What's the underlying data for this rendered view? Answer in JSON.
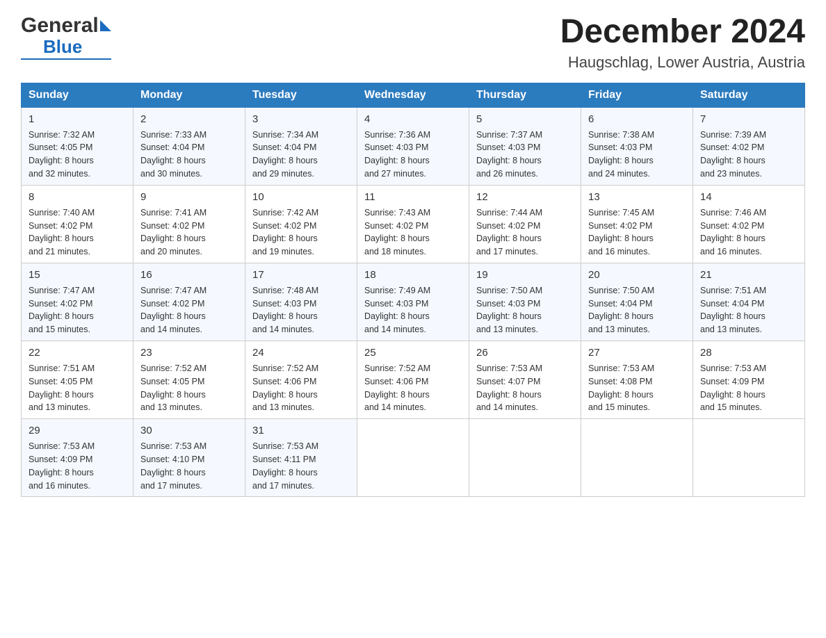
{
  "logo": {
    "general": "General",
    "blue": "Blue"
  },
  "title": "December 2024",
  "location": "Haugschlag, Lower Austria, Austria",
  "weekdays": [
    "Sunday",
    "Monday",
    "Tuesday",
    "Wednesday",
    "Thursday",
    "Friday",
    "Saturday"
  ],
  "weeks": [
    [
      {
        "day": "1",
        "sunrise": "7:32 AM",
        "sunset": "4:05 PM",
        "daylight": "8 hours and 32 minutes."
      },
      {
        "day": "2",
        "sunrise": "7:33 AM",
        "sunset": "4:04 PM",
        "daylight": "8 hours and 30 minutes."
      },
      {
        "day": "3",
        "sunrise": "7:34 AM",
        "sunset": "4:04 PM",
        "daylight": "8 hours and 29 minutes."
      },
      {
        "day": "4",
        "sunrise": "7:36 AM",
        "sunset": "4:03 PM",
        "daylight": "8 hours and 27 minutes."
      },
      {
        "day": "5",
        "sunrise": "7:37 AM",
        "sunset": "4:03 PM",
        "daylight": "8 hours and 26 minutes."
      },
      {
        "day": "6",
        "sunrise": "7:38 AM",
        "sunset": "4:03 PM",
        "daylight": "8 hours and 24 minutes."
      },
      {
        "day": "7",
        "sunrise": "7:39 AM",
        "sunset": "4:02 PM",
        "daylight": "8 hours and 23 minutes."
      }
    ],
    [
      {
        "day": "8",
        "sunrise": "7:40 AM",
        "sunset": "4:02 PM",
        "daylight": "8 hours and 21 minutes."
      },
      {
        "day": "9",
        "sunrise": "7:41 AM",
        "sunset": "4:02 PM",
        "daylight": "8 hours and 20 minutes."
      },
      {
        "day": "10",
        "sunrise": "7:42 AM",
        "sunset": "4:02 PM",
        "daylight": "8 hours and 19 minutes."
      },
      {
        "day": "11",
        "sunrise": "7:43 AM",
        "sunset": "4:02 PM",
        "daylight": "8 hours and 18 minutes."
      },
      {
        "day": "12",
        "sunrise": "7:44 AM",
        "sunset": "4:02 PM",
        "daylight": "8 hours and 17 minutes."
      },
      {
        "day": "13",
        "sunrise": "7:45 AM",
        "sunset": "4:02 PM",
        "daylight": "8 hours and 16 minutes."
      },
      {
        "day": "14",
        "sunrise": "7:46 AM",
        "sunset": "4:02 PM",
        "daylight": "8 hours and 16 minutes."
      }
    ],
    [
      {
        "day": "15",
        "sunrise": "7:47 AM",
        "sunset": "4:02 PM",
        "daylight": "8 hours and 15 minutes."
      },
      {
        "day": "16",
        "sunrise": "7:47 AM",
        "sunset": "4:02 PM",
        "daylight": "8 hours and 14 minutes."
      },
      {
        "day": "17",
        "sunrise": "7:48 AM",
        "sunset": "4:03 PM",
        "daylight": "8 hours and 14 minutes."
      },
      {
        "day": "18",
        "sunrise": "7:49 AM",
        "sunset": "4:03 PM",
        "daylight": "8 hours and 14 minutes."
      },
      {
        "day": "19",
        "sunrise": "7:50 AM",
        "sunset": "4:03 PM",
        "daylight": "8 hours and 13 minutes."
      },
      {
        "day": "20",
        "sunrise": "7:50 AM",
        "sunset": "4:04 PM",
        "daylight": "8 hours and 13 minutes."
      },
      {
        "day": "21",
        "sunrise": "7:51 AM",
        "sunset": "4:04 PM",
        "daylight": "8 hours and 13 minutes."
      }
    ],
    [
      {
        "day": "22",
        "sunrise": "7:51 AM",
        "sunset": "4:05 PM",
        "daylight": "8 hours and 13 minutes."
      },
      {
        "day": "23",
        "sunrise": "7:52 AM",
        "sunset": "4:05 PM",
        "daylight": "8 hours and 13 minutes."
      },
      {
        "day": "24",
        "sunrise": "7:52 AM",
        "sunset": "4:06 PM",
        "daylight": "8 hours and 13 minutes."
      },
      {
        "day": "25",
        "sunrise": "7:52 AM",
        "sunset": "4:06 PM",
        "daylight": "8 hours and 14 minutes."
      },
      {
        "day": "26",
        "sunrise": "7:53 AM",
        "sunset": "4:07 PM",
        "daylight": "8 hours and 14 minutes."
      },
      {
        "day": "27",
        "sunrise": "7:53 AM",
        "sunset": "4:08 PM",
        "daylight": "8 hours and 15 minutes."
      },
      {
        "day": "28",
        "sunrise": "7:53 AM",
        "sunset": "4:09 PM",
        "daylight": "8 hours and 15 minutes."
      }
    ],
    [
      {
        "day": "29",
        "sunrise": "7:53 AM",
        "sunset": "4:09 PM",
        "daylight": "8 hours and 16 minutes."
      },
      {
        "day": "30",
        "sunrise": "7:53 AM",
        "sunset": "4:10 PM",
        "daylight": "8 hours and 17 minutes."
      },
      {
        "day": "31",
        "sunrise": "7:53 AM",
        "sunset": "4:11 PM",
        "daylight": "8 hours and 17 minutes."
      },
      null,
      null,
      null,
      null
    ]
  ],
  "labels": {
    "sunrise": "Sunrise:",
    "sunset": "Sunset:",
    "daylight": "Daylight:"
  }
}
